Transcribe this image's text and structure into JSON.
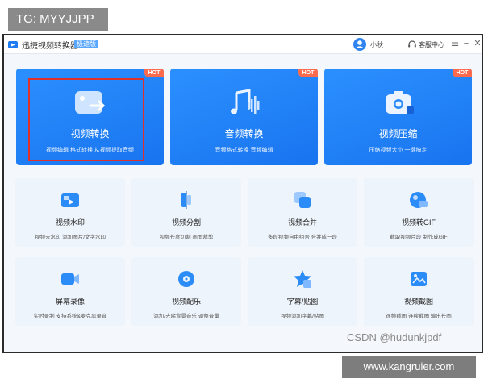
{
  "overlay": {
    "tag_top": "TG: MYYJJPP",
    "watermark_csdn": "CSDN @hudunkjpdf",
    "watermark_site": "www.kangruier.com"
  },
  "titlebar": {
    "app_name": "迅捷视频转换器",
    "version_badge": "极速版",
    "username": "小秋",
    "support_label": "客服中心",
    "menu_symbol": "☰",
    "minimize_symbol": "−",
    "close_symbol": "✕"
  },
  "feature_cards": [
    {
      "title": "视频转换",
      "desc": "视频编辑 格式转换 从视频提取音频",
      "hot": "HOT",
      "icon": "video-convert-icon"
    },
    {
      "title": "音频转换",
      "desc": "音频格式转换 音频编辑",
      "hot": "HOT",
      "icon": "music-note-icon"
    },
    {
      "title": "视频压缩",
      "desc": "压缩视频大小 一键搞定",
      "hot": "HOT",
      "icon": "camera-compress-icon"
    }
  ],
  "tools": [
    {
      "title": "视频水印",
      "desc": "视频去水印 添加图片/文字水印",
      "icon": "watermark-icon",
      "color": "#2c8cf7"
    },
    {
      "title": "视频分割",
      "desc": "视频长度切割 画面裁剪",
      "icon": "scissors-icon",
      "color": "#2c8cf7"
    },
    {
      "title": "视频合并",
      "desc": "多段视频自由组合 合并成一段",
      "icon": "merge-icon",
      "color": "#2c8cf7"
    },
    {
      "title": "视频转GIF",
      "desc": "截取视频片段 制作成GIF",
      "icon": "gif-icon",
      "color": "#2c8cf7"
    },
    {
      "title": "屏幕录像",
      "desc": "实时录制 支持系统&麦克风录音",
      "icon": "screen-record-icon",
      "color": "#2c8cf7"
    },
    {
      "title": "视频配乐",
      "desc": "添加/去除背景音乐 调整音量",
      "icon": "soundtrack-icon",
      "color": "#2c8cf7"
    },
    {
      "title": "字幕/贴图",
      "desc": "视频添加字幕/贴图",
      "icon": "subtitle-icon",
      "color": "#2c8cf7"
    },
    {
      "title": "视频截图",
      "desc": "逐帧截图 连续截图 输出长图",
      "icon": "screenshot-icon",
      "color": "#2c8cf7"
    }
  ]
}
